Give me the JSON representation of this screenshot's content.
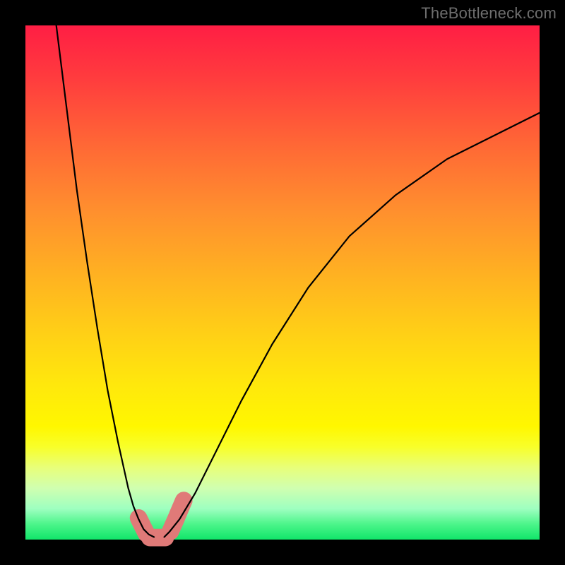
{
  "attribution": "TheBottleneck.com",
  "colors": {
    "background_frame": "#000000",
    "gradient_top": "#ff1e44",
    "gradient_mid1": "#ff8f2e",
    "gradient_mid2": "#ffe80c",
    "gradient_bottom": "#11e56a",
    "curve": "#000000",
    "blob": "#e07a78",
    "attribution_text": "#6e6e6e"
  },
  "chart_data": {
    "type": "line",
    "title": "",
    "xlabel": "",
    "ylabel": "",
    "xlim": [
      0,
      100
    ],
    "ylim": [
      0,
      100
    ],
    "grid": false,
    "legend": false,
    "series": [
      {
        "name": "left-branch",
        "x": [
          6,
          8,
          10,
          12,
          14,
          16,
          18,
          20,
          21,
          22,
          23,
          24,
          25
        ],
        "y": [
          100,
          84,
          68,
          54,
          41,
          29,
          19,
          10,
          6.5,
          4,
          2,
          1,
          0.5
        ]
      },
      {
        "name": "right-branch",
        "x": [
          27,
          28,
          30,
          33,
          37,
          42,
          48,
          55,
          63,
          72,
          82,
          92,
          100
        ],
        "y": [
          0.5,
          1.5,
          4,
          9,
          17,
          27,
          38,
          49,
          59,
          67,
          74,
          79,
          83
        ]
      }
    ],
    "overlays": [
      {
        "name": "blob-left",
        "type": "capsule",
        "x1": 22,
        "y1": 4.2,
        "x2": 23.5,
        "y2": 1.2,
        "r": 1.7
      },
      {
        "name": "blob-bottom",
        "type": "capsule",
        "x1": 24.2,
        "y1": 0.4,
        "x2": 27.2,
        "y2": 0.4,
        "r": 1.7
      },
      {
        "name": "blob-right-lower",
        "type": "capsule",
        "x1": 28.2,
        "y1": 1.6,
        "x2": 29.4,
        "y2": 4.3,
        "r": 1.7
      },
      {
        "name": "blob-right-upper",
        "type": "capsule",
        "x1": 29.6,
        "y1": 4.8,
        "x2": 30.8,
        "y2": 7.6,
        "r": 1.7
      }
    ],
    "notes": "Curve values are estimated from pixel positions relative to the visible plot area; the image has no axes, ticks, or data labels."
  }
}
